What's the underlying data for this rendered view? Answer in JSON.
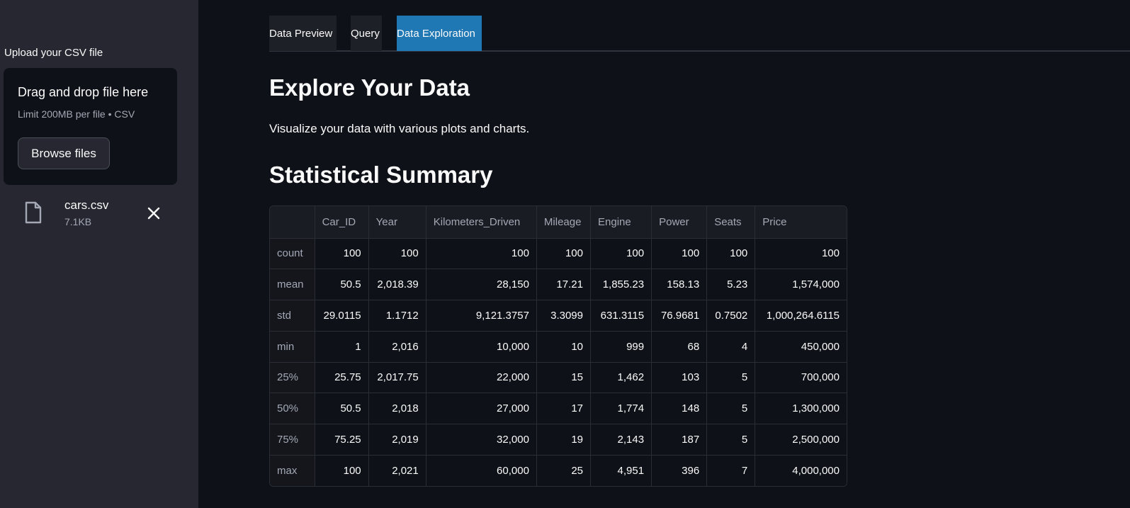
{
  "sidebar": {
    "upload_label": "Upload your CSV file",
    "dropzone": {
      "title": "Drag and drop file here",
      "limit": "Limit 200MB per file • CSV",
      "browse_label": "Browse files"
    },
    "file": {
      "name": "cars.csv",
      "size": "7.1KB",
      "icon": "file-icon",
      "remove_icon": "close-icon"
    }
  },
  "tabs": [
    {
      "label": "Data Preview",
      "active": false
    },
    {
      "label": "Query",
      "active": false
    },
    {
      "label": "Data Exploration",
      "active": true
    }
  ],
  "main": {
    "heading": "Explore Your Data",
    "caption": "Visualize your data with various plots and charts.",
    "summary_heading": "Statistical Summary"
  },
  "table": {
    "columns": [
      "",
      "Car_ID",
      "Year",
      "Kilometers_Driven",
      "Mileage",
      "Engine",
      "Power",
      "Seats",
      "Price"
    ],
    "rows": [
      [
        "count",
        "100",
        "100",
        "100",
        "100",
        "100",
        "100",
        "100",
        "100"
      ],
      [
        "mean",
        "50.5",
        "2,018.39",
        "28,150",
        "17.21",
        "1,855.23",
        "158.13",
        "5.23",
        "1,574,000"
      ],
      [
        "std",
        "29.0115",
        "1.1712",
        "9,121.3757",
        "3.3099",
        "631.3115",
        "76.9681",
        "0.7502",
        "1,000,264.6115"
      ],
      [
        "min",
        "1",
        "2,016",
        "10,000",
        "10",
        "999",
        "68",
        "4",
        "450,000"
      ],
      [
        "25%",
        "25.75",
        "2,017.75",
        "22,000",
        "15",
        "1,462",
        "103",
        "5",
        "700,000"
      ],
      [
        "50%",
        "50.5",
        "2,018",
        "27,000",
        "17",
        "1,774",
        "148",
        "5",
        "1,300,000"
      ],
      [
        "75%",
        "75.25",
        "2,019",
        "32,000",
        "19",
        "2,143",
        "187",
        "5",
        "2,500,000"
      ],
      [
        "max",
        "100",
        "2,021",
        "60,000",
        "25",
        "4,951",
        "396",
        "7",
        "4,000,000"
      ]
    ]
  },
  "colors": {
    "background": "#0e1117",
    "sidebar": "#262730",
    "accent": "#1f77b4"
  }
}
